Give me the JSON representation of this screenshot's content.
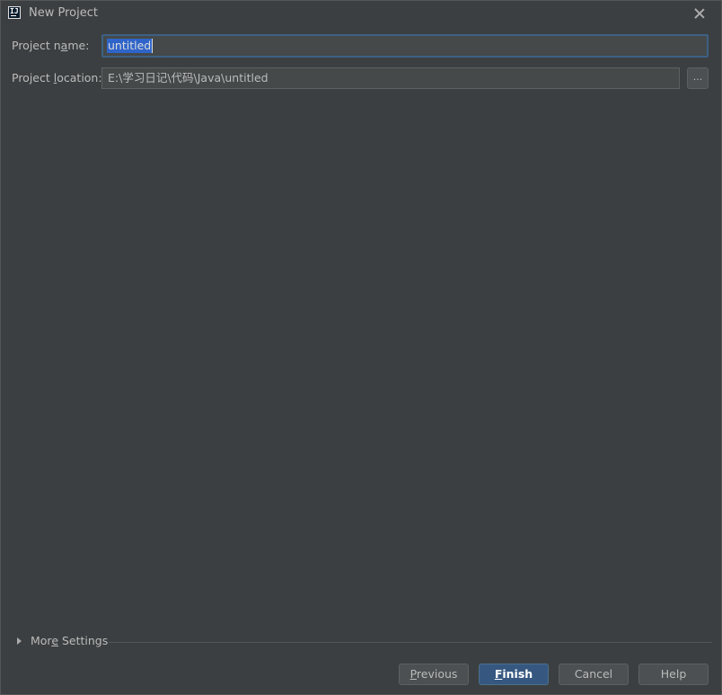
{
  "window": {
    "title": "New Project",
    "app_icon_text": "IJ"
  },
  "form": {
    "name_label_pre": "Project n",
    "name_label_mnemonic": "a",
    "name_label_post": "me:",
    "name_value": "untitled",
    "location_label_pre": "Project ",
    "location_label_mnemonic": "l",
    "location_label_post": "ocation:",
    "location_value": "E:\\学习日记\\代码\\Java\\untitled",
    "browse_label": "..."
  },
  "more_settings": {
    "label_pre": "Mor",
    "label_mnemonic": "e",
    "label_post": " Settings",
    "expanded": false
  },
  "buttons": {
    "previous_mnemonic": "P",
    "previous_rest": "revious",
    "finish_mnemonic": "F",
    "finish_rest": "inish",
    "cancel": "Cancel",
    "help": "Help"
  },
  "colors": {
    "background": "#3c3f41",
    "selection": "#2f65ca",
    "focus_border": "#3d6185",
    "default_button": "#365880"
  }
}
